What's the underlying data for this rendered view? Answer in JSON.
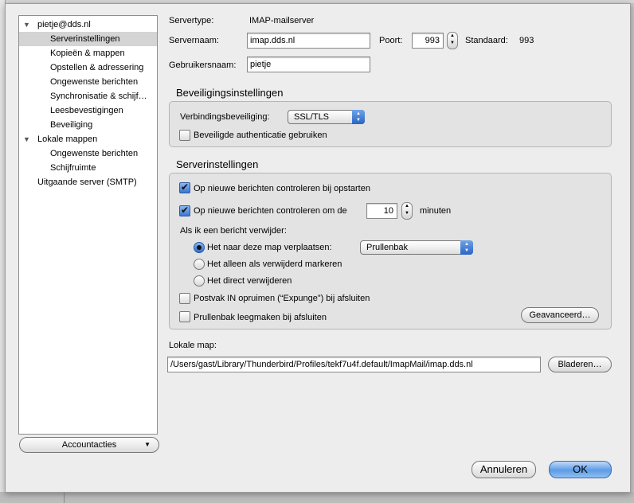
{
  "account_tree": [
    {
      "label": "pietje@dds.nl",
      "expanded": true,
      "indent": 0,
      "selected": false
    },
    {
      "label": "Serverinstellingen",
      "indent": 1,
      "selected": true
    },
    {
      "label": "Kopieën & mappen",
      "indent": 1,
      "selected": false
    },
    {
      "label": "Opstellen & adressering",
      "indent": 1,
      "selected": false
    },
    {
      "label": "Ongewenste berichten",
      "indent": 1,
      "selected": false
    },
    {
      "label": "Synchronisatie & schijf…",
      "indent": 1,
      "selected": false
    },
    {
      "label": "Leesbevestigingen",
      "indent": 1,
      "selected": false
    },
    {
      "label": "Beveiliging",
      "indent": 1,
      "selected": false
    },
    {
      "label": "Lokale mappen",
      "expanded": true,
      "indent": 0,
      "selected": false
    },
    {
      "label": "Ongewenste berichten",
      "indent": 1,
      "selected": false
    },
    {
      "label": "Schijfruimte",
      "indent": 1,
      "selected": false
    },
    {
      "label": "Uitgaande server (SMTP)",
      "indent": 0,
      "selected": false
    }
  ],
  "account_actions_label": "Accountacties",
  "server": {
    "type_label": "Servertype:",
    "type_value": "IMAP-mailserver",
    "name_label": "Servernaam:",
    "name_value": "imap.dds.nl",
    "port_label": "Poort:",
    "port_value": "993",
    "default_label": "Standaard:",
    "default_value": "993",
    "user_label": "Gebruikersnaam:",
    "user_value": "pietje"
  },
  "security": {
    "title": "Beveiligingsinstellingen",
    "conn_label": "Verbindingsbeveiliging:",
    "conn_value": "SSL/TLS",
    "secure_auth_label": "Beveiligde authenticatie gebruiken",
    "secure_auth_checked": false
  },
  "settings": {
    "title": "Serverinstellingen",
    "check_startup_label": "Op nieuwe berichten controleren bij opstarten",
    "check_startup_checked": true,
    "check_every_label": "Op nieuwe berichten controleren om de",
    "check_every_checked": true,
    "check_every_value": "10",
    "minutes_label": "minuten",
    "delete_label": "Als ik een bericht verwijder:",
    "radio_move_label": "Het naar deze map verplaatsen:",
    "radio_move_folder": "Prullenbak",
    "radio_mark_label": "Het alleen als verwijderd markeren",
    "radio_direct_label": "Het direct verwijderen",
    "selected_radio": "move",
    "expunge_label": "Postvak IN opruimen (“Expunge”) bij afsluiten",
    "expunge_checked": false,
    "empty_trash_label": "Prullenbak leegmaken bij afsluiten",
    "empty_trash_checked": false,
    "advanced_label": "Geavanceerd…"
  },
  "local": {
    "label": "Lokale map:",
    "path": "/Users/gast/Library/Thunderbird/Profiles/tekf7u4f.default/ImapMail/imap.dds.nl",
    "browse_label": "Bladeren…"
  },
  "buttons": {
    "cancel": "Annuleren",
    "ok": "OK"
  },
  "colors": {
    "accent": "#3b76cf",
    "selection": "#d4d4d4"
  }
}
